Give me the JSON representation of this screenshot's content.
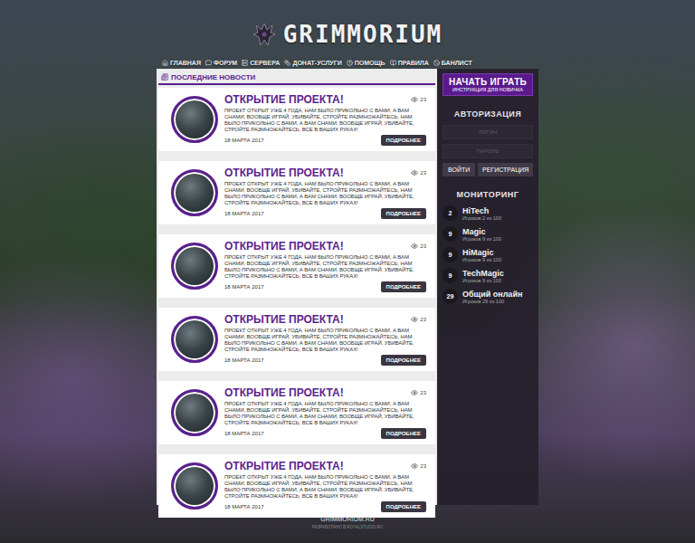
{
  "logo": {
    "text": "GRIMMORIUM"
  },
  "nav": [
    {
      "label": "ГЛАВНАЯ"
    },
    {
      "label": "ФОРУМ"
    },
    {
      "label": "СЕРВЕРА"
    },
    {
      "label": "ДОНАТ-УСЛУГИ"
    },
    {
      "label": "ПОМОЩЬ"
    },
    {
      "label": "ПРАВИЛА"
    },
    {
      "label": "БАНЛИСТ"
    }
  ],
  "news": {
    "title": "ПОСЛЕДНИЕ НОВОСТИ",
    "items": [
      {
        "title": "ОТКРЫТИЕ ПРОЕКТА!",
        "views": "23",
        "text": "ПРОЕКТ ОТКРЫТ УЖЕ 4 ГОДА, НАМ БЫЛО ПРИКОЛЬНО С ВАМИ, А ВАМ СНАМИ, ВООБЩЕ ИГРАЙ, УБИВАЙТЕ, СТРОЙТЕ РАЗМНОЖАЙТЕСЬ, НАМ БЫЛО ПРИКОЛЬНО С ВАМИ, А ВАМ СНАМИ, ВООБЩЕ ИГРАЙ, УБИВАЙТЕ, СТРОЙТЕ РАЗМНОЖАЙТЕСЬ, ВСЕ В ВАШИХ РУКАХ!",
        "date": "18 МАРТА 2017",
        "button": "ПОДРОБНЕЕ"
      },
      {
        "title": "ОТКРЫТИЕ ПРОЕКТА!",
        "views": "23",
        "text": "ПРОЕКТ ОТКРЫТ УЖЕ 4 ГОДА, НАМ БЫЛО ПРИКОЛЬНО С ВАМИ, А ВАМ СНАМИ, ВООБЩЕ ИГРАЙ, УБИВАЙТЕ, СТРОЙТЕ РАЗМНОЖАЙТЕСЬ, НАМ БЫЛО ПРИКОЛЬНО С ВАМИ, А ВАМ СНАМИ, ВООБЩЕ ИГРАЙ, УБИВАЙТЕ, СТРОЙТЕ РАЗМНОЖАЙТЕСЬ, ВСЕ В ВАШИХ РУКАХ!",
        "date": "18 МАРТА 2017",
        "button": "ПОДРОБНЕЕ"
      },
      {
        "title": "ОТКРЫТИЕ ПРОЕКТА!",
        "views": "23",
        "text": "ПРОЕКТ ОТКРЫТ УЖЕ 4 ГОДА, НАМ БЫЛО ПРИКОЛЬНО С ВАМИ, А ВАМ СНАМИ, ВООБЩЕ ИГРАЙ, УБИВАЙТЕ, СТРОЙТЕ РАЗМНОЖАЙТЕСЬ, НАМ БЫЛО ПРИКОЛЬНО С ВАМИ, А ВАМ СНАМИ, ВООБЩЕ ИГРАЙ, УБИВАЙТЕ, СТРОЙТЕ РАЗМНОЖАЙТЕСЬ, ВСЕ В ВАШИХ РУКАХ!",
        "date": "18 МАРТА 2017",
        "button": "ПОДРОБНЕЕ"
      },
      {
        "title": "ОТКРЫТИЕ ПРОЕКТА!",
        "views": "23",
        "text": "ПРОЕКТ ОТКРЫТ УЖЕ 4 ГОДА, НАМ БЫЛО ПРИКОЛЬНО С ВАМИ, А ВАМ СНАМИ, ВООБЩЕ ИГРАЙ, УБИВАЙТЕ, СТРОЙТЕ РАЗМНОЖАЙТЕСЬ, НАМ БЫЛО ПРИКОЛЬНО С ВАМИ, А ВАМ СНАМИ, ВООБЩЕ ИГРАЙ, УБИВАЙТЕ, СТРОЙТЕ РАЗМНОЖАЙТЕСЬ, ВСЕ В ВАШИХ РУКАХ!",
        "date": "18 МАРТА 2017",
        "button": "ПОДРОБНЕЕ"
      },
      {
        "title": "ОТКРЫТИЕ ПРОЕКТА!",
        "views": "23",
        "text": "ПРОЕКТ ОТКРЫТ УЖЕ 4 ГОДА, НАМ БЫЛО ПРИКОЛЬНО С ВАМИ, А ВАМ СНАМИ, ВООБЩЕ ИГРАЙ, УБИВАЙТЕ, СТРОЙТЕ РАЗМНОЖАЙТЕСЬ, НАМ БЫЛО ПРИКОЛЬНО С ВАМИ, А ВАМ СНАМИ, ВООБЩЕ ИГРАЙ, УБИВАЙТЕ, СТРОЙТЕ РАЗМНОЖАЙТЕСЬ, ВСЕ В ВАШИХ РУКАХ!",
        "date": "18 МАРТА 2017",
        "button": "ПОДРОБНЕЕ"
      },
      {
        "title": "ОТКРЫТИЕ ПРОЕКТА!",
        "views": "23",
        "text": "ПРОЕКТ ОТКРЫТ УЖЕ 4 ГОДА, НАМ БЫЛО ПРИКОЛЬНО С ВАМИ, А ВАМ СНАМИ, ВООБЩЕ ИГРАЙ, УБИВАЙТЕ, СТРОЙТЕ РАЗМНОЖАЙТЕСЬ, НАМ БЫЛО ПРИКОЛЬНО С ВАМИ, А ВАМ СНАМИ, ВООБЩЕ ИГРАЙ, УБИВАЙТЕ, СТРОЙТЕ РАЗМНОЖАЙТЕСЬ, ВСЕ В ВАШИХ РУКАХ!",
        "date": "18 МАРТА 2017",
        "button": "ПОДРОБНЕЕ"
      }
    ]
  },
  "sidebar": {
    "play": {
      "label": "НАЧАТЬ ИГРАТЬ",
      "sub": "ИНСТРУКЦИЯ ДЛЯ НОВИЧКА"
    },
    "auth": {
      "title": "АВТОРИЗАЦИЯ",
      "login_placeholder": "ЛОГИН",
      "password_placeholder": "ПАРОЛЬ",
      "buttons": [
        "ВОЙТИ",
        "РЕГИСТРАЦИЯ"
      ]
    },
    "monitoring": {
      "title": "МОНИТОРИНГ",
      "servers": [
        {
          "name": "HiTech",
          "online": "2",
          "players": "Игроков 2 из 100"
        },
        {
          "name": "Magic",
          "online": "9",
          "players": "Игроков 9 из 100"
        },
        {
          "name": "HiMagic",
          "online": "9",
          "players": "Игроков 9 из 100"
        },
        {
          "name": "TechMagic",
          "online": "9",
          "players": "Игроков 9 из 100"
        },
        {
          "name": "Общий онлайн",
          "online": "29",
          "players": "Игроков 29 из 100"
        }
      ]
    }
  },
  "footer": {
    "site": "GRIMMORIUM.RU",
    "credit": "РАЗРАБОТАНО В ROYALSTUDIO.RU"
  }
}
